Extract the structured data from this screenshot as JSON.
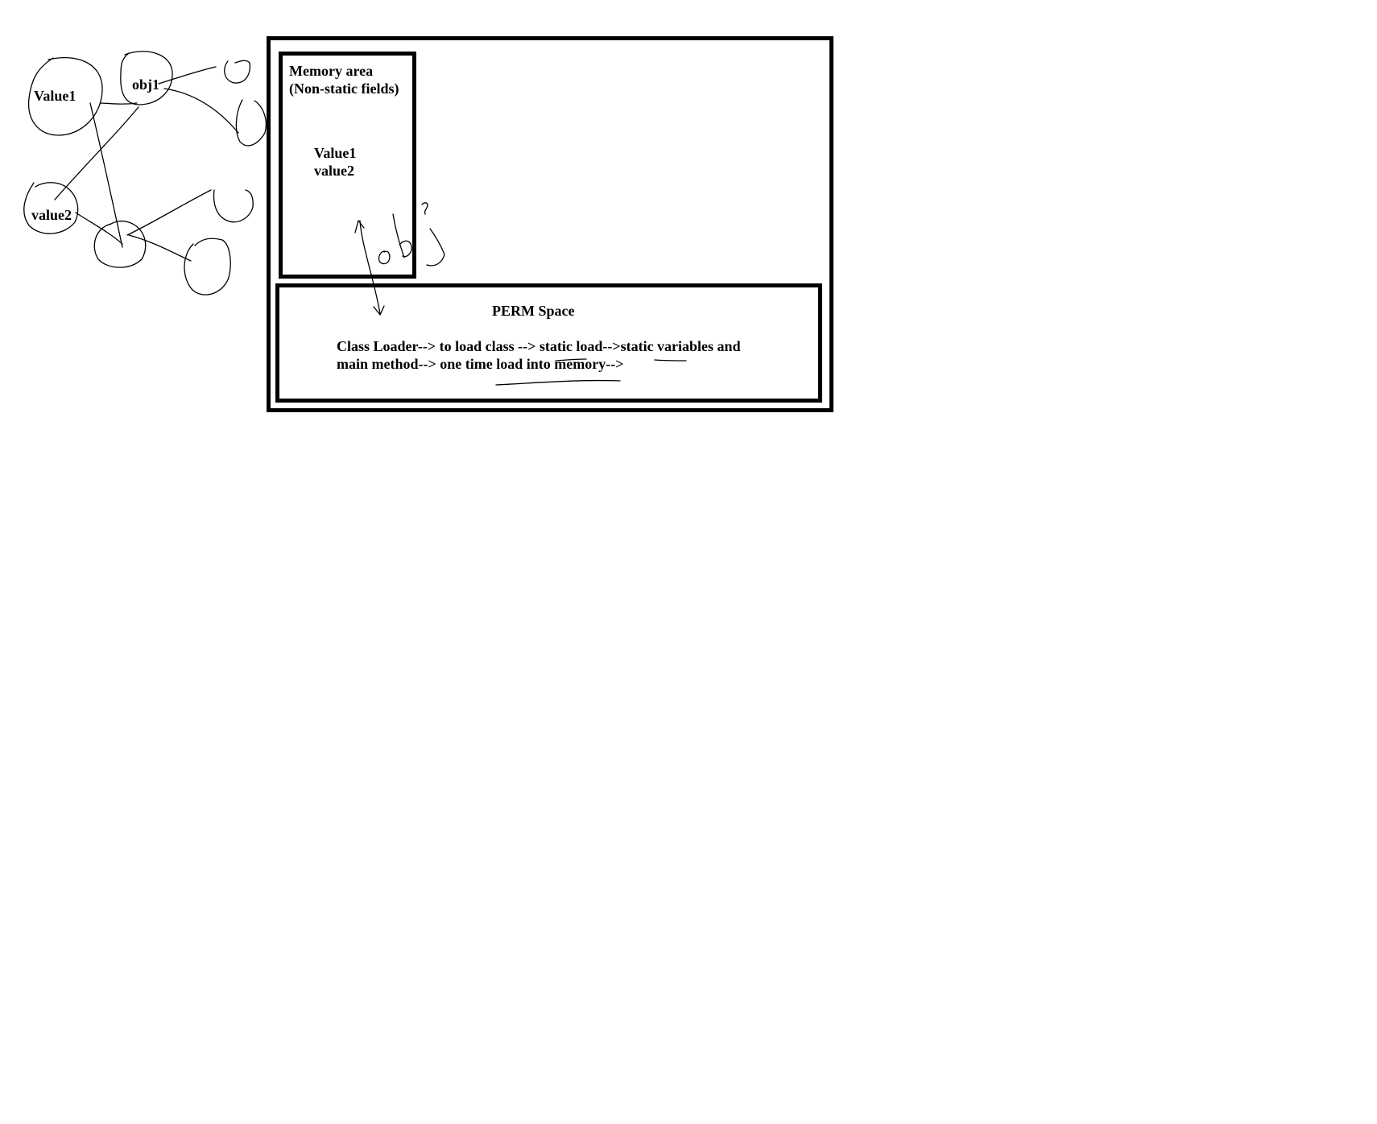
{
  "memory_area": {
    "title": "Memory area",
    "subtitle": "(Non-static fields)",
    "fields": [
      "Value1",
      "value2"
    ]
  },
  "perm_space": {
    "title": "PERM Space",
    "lines": [
      "Class Loader--> to load class --> static load-->static variables and",
      "main method--> one time load into memory-->"
    ]
  },
  "sketch_nodes": {
    "value1": "Value1",
    "obj1": "obj1",
    "value2": "value2"
  }
}
